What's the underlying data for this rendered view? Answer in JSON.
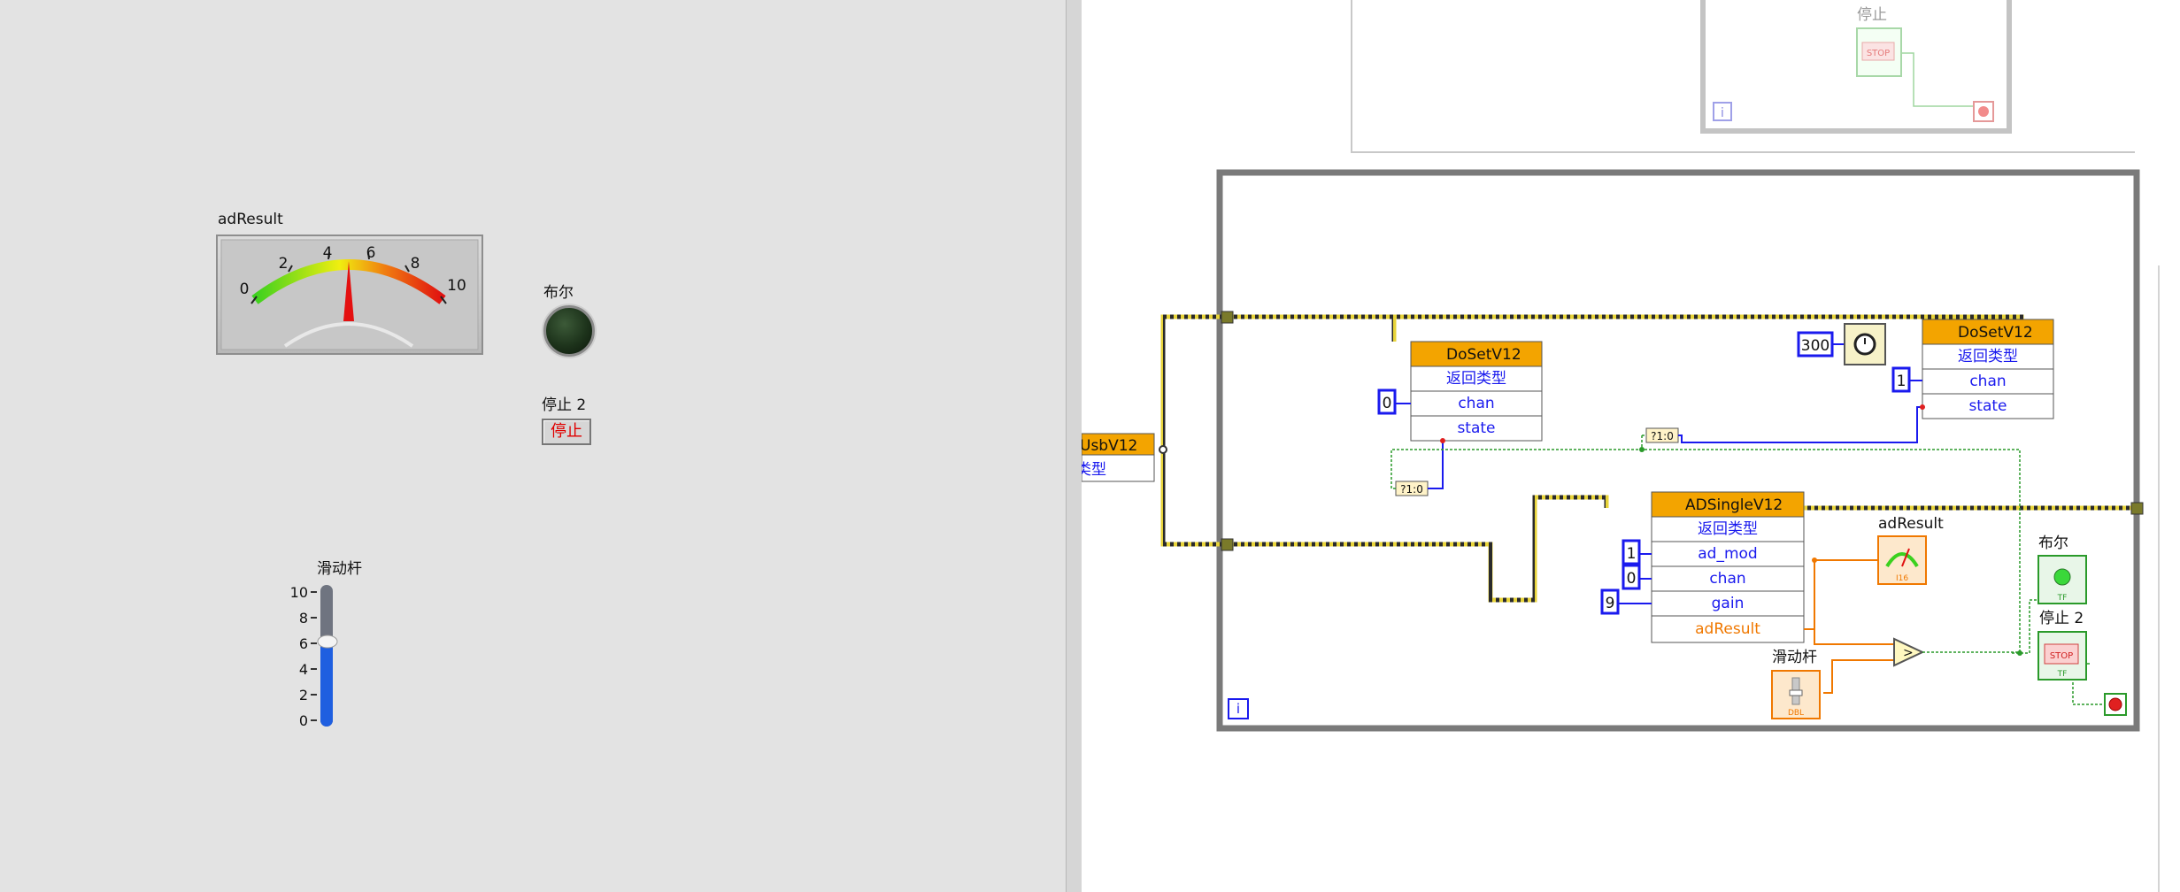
{
  "front_panel": {
    "gauge_label": "adResult",
    "gauge_ticks": [
      "0",
      "2",
      "4",
      "6",
      "8",
      "10"
    ],
    "gauge_value": 5,
    "led_label": "布尔",
    "stop_label": "停止 2",
    "stop_button_text": "停止",
    "slider_label": "滑动杆",
    "slider_ticks": [
      "10",
      "8",
      "6",
      "4",
      "2",
      "0"
    ],
    "slider_value": 6
  },
  "block_diagram": {
    "top_loop_stop_label": "停止",
    "top_stop_text": "STOP",
    "left_node": {
      "title": "UsbV12",
      "row": "类型"
    },
    "node_dosetv12_a": {
      "title": "DoSetV12",
      "rows": [
        "返回类型",
        "chan",
        "state"
      ],
      "const_chan": "0"
    },
    "node_dosetv12_b": {
      "title": "DoSetV12",
      "rows": [
        "返回类型",
        "chan",
        "state"
      ],
      "const_chan": "1"
    },
    "wait_const": "300",
    "select_text": "?1:0",
    "node_adsingle": {
      "title": "ADSingleV12",
      "rows": [
        "返回类型",
        "ad_mod",
        "chan",
        "gain",
        "adResult"
      ],
      "consts": [
        "1",
        "0",
        "9"
      ]
    },
    "term_adresult_label": "adResult",
    "term_led_label": "布尔",
    "term_stop_label": "停止 2",
    "term_stop_text": "STOP",
    "term_slider_label": "滑动杆",
    "term_dbl": "DBL",
    "term_tf": "TF",
    "term_i16": "I16",
    "iteration": "i"
  }
}
